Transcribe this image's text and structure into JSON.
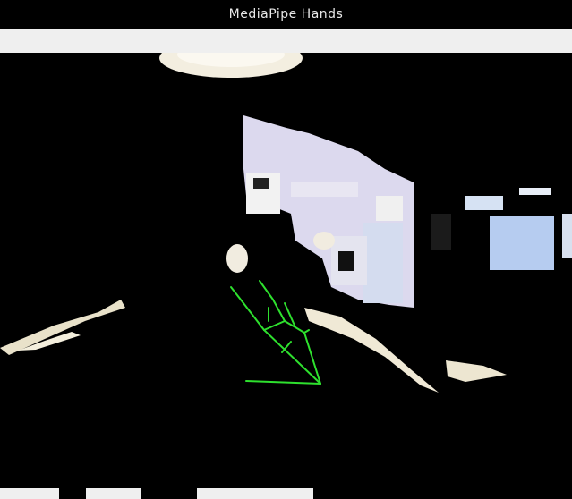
{
  "window": {
    "title": "MediaPipe Hands"
  },
  "colors": {
    "landmark_line": "#2ee02e",
    "titlebar_bg": "#000000",
    "toolbar_bg": "#efefef"
  },
  "viewport": {
    "content": "camera-feed-with-hand-landmarks"
  }
}
